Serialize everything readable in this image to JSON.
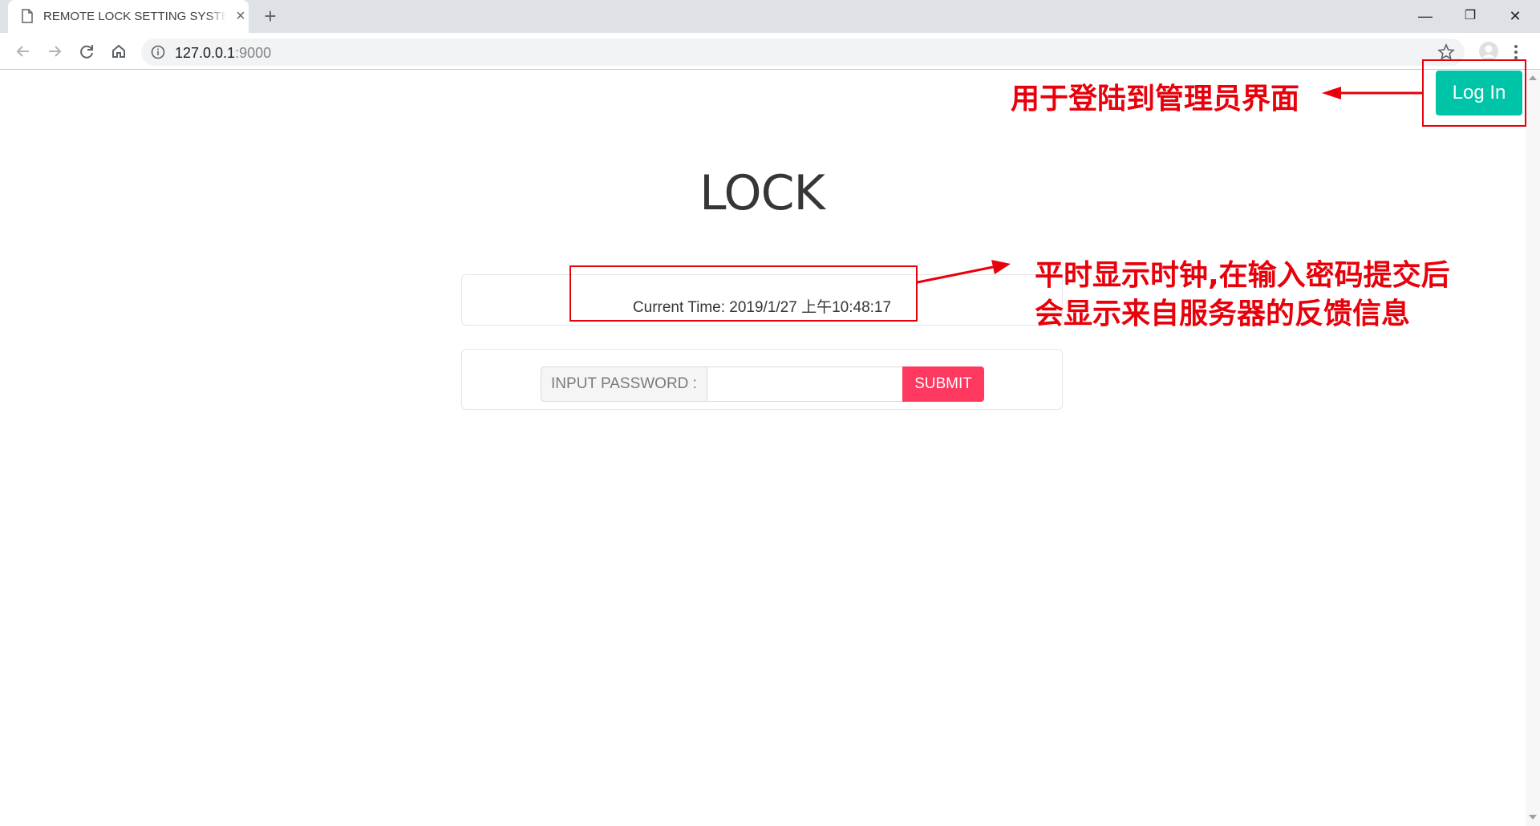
{
  "browser": {
    "tab": {
      "title": "REMOTE LOCK SETTING SYSTE",
      "close_icon": "×",
      "new_tab_icon": "+"
    },
    "window_controls": {
      "minimize": "—",
      "restore": "❐",
      "close": "✕"
    },
    "address_bar": {
      "host": "127.0.0.1",
      "port": ":9000"
    }
  },
  "page": {
    "login_label": "Log In",
    "title": "LOCK",
    "clock_text": "Current Time: 2019/1/27 上午10:48:17",
    "form": {
      "label": "INPUT PASSWORD :",
      "input_value": "",
      "input_placeholder": "",
      "submit_label": "SUBMIT"
    }
  },
  "annotations": {
    "login_note": "用于登陆到管理员界面",
    "clock_note_line1": "平时显示时钟,在输入密码提交后",
    "clock_note_line2": "会显示来自服务器的反馈信息",
    "color": "#e8000b"
  },
  "colors": {
    "login_button": "#00c4a7",
    "submit_button": "#ff3860"
  }
}
